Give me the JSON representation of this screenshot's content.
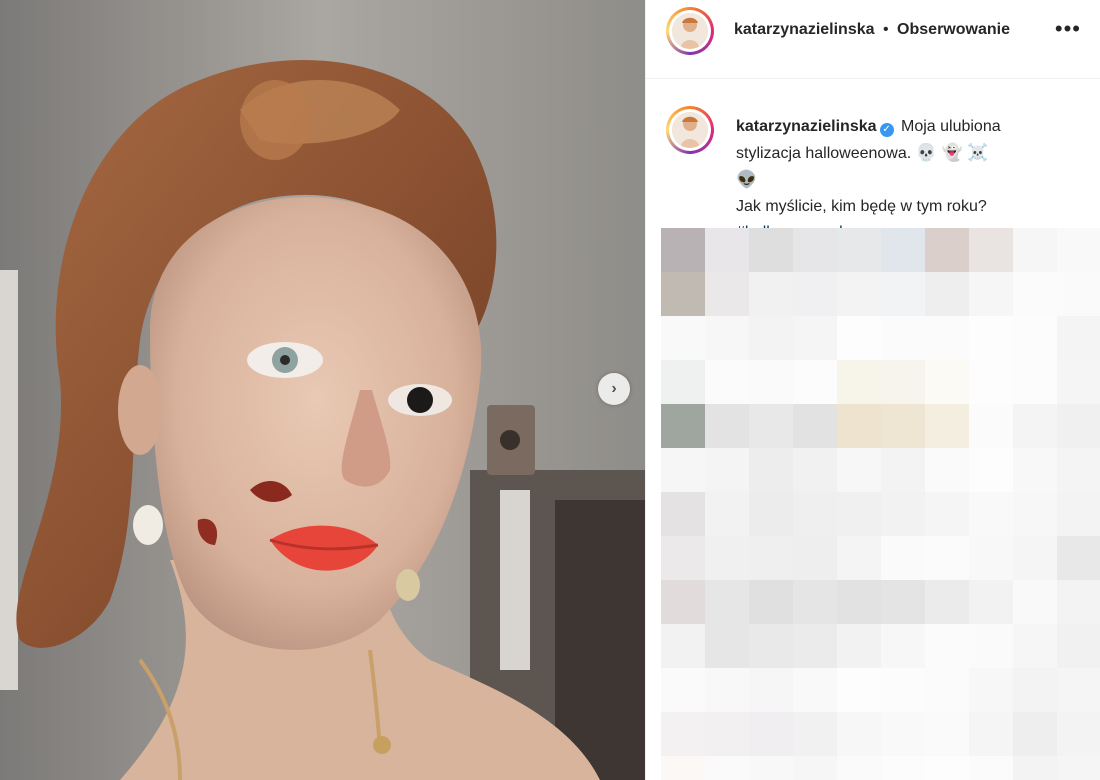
{
  "header": {
    "username": "katarzynazielinska",
    "separator": "•",
    "follow_label": "Obserwowanie",
    "more_icon": "more-options-icon"
  },
  "caption": {
    "username": "katarzynazielinska",
    "verified": true,
    "line1": "Moja ulubiona stylizacja halloweenowa.",
    "emoji1": "💀 👻 ☠️",
    "emoji2": "👽",
    "line2": "Jak myślicie, kim będę w tym roku?",
    "hashtag": "#halloweenmakeup"
  },
  "carousel": {
    "next_icon": "chevron-right-icon"
  },
  "colors": {
    "text": "#262626",
    "hashtag": "#00376b",
    "verified": "#3897f0",
    "border": "#efefef"
  }
}
